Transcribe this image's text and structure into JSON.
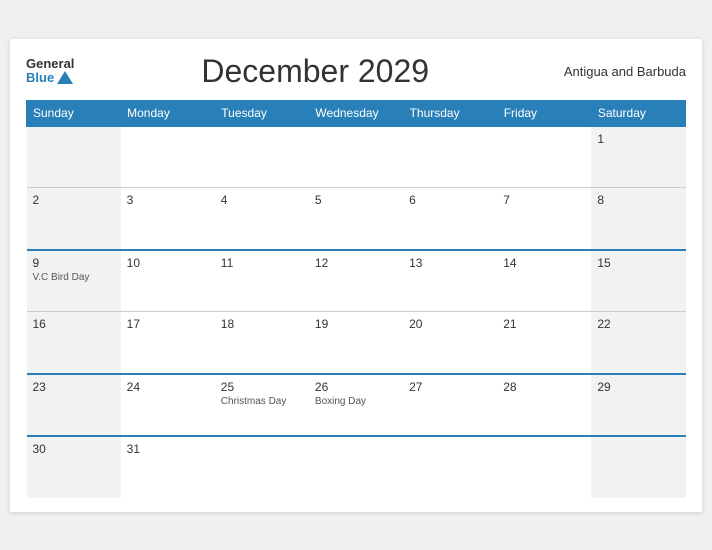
{
  "header": {
    "logo_general": "General",
    "logo_blue": "Blue",
    "title": "December 2029",
    "country": "Antigua and Barbuda"
  },
  "weekdays": [
    "Sunday",
    "Monday",
    "Tuesday",
    "Wednesday",
    "Thursday",
    "Friday",
    "Saturday"
  ],
  "weeks": [
    [
      {
        "day": "",
        "holiday": "",
        "type": "sunday"
      },
      {
        "day": "",
        "holiday": "",
        "type": ""
      },
      {
        "day": "",
        "holiday": "",
        "type": ""
      },
      {
        "day": "",
        "holiday": "",
        "type": ""
      },
      {
        "day": "",
        "holiday": "",
        "type": ""
      },
      {
        "day": "",
        "holiday": "",
        "type": ""
      },
      {
        "day": "1",
        "holiday": "",
        "type": "saturday"
      }
    ],
    [
      {
        "day": "2",
        "holiday": "",
        "type": "sunday"
      },
      {
        "day": "3",
        "holiday": "",
        "type": ""
      },
      {
        "day": "4",
        "holiday": "",
        "type": ""
      },
      {
        "day": "5",
        "holiday": "",
        "type": ""
      },
      {
        "day": "6",
        "holiday": "",
        "type": ""
      },
      {
        "day": "7",
        "holiday": "",
        "type": ""
      },
      {
        "day": "8",
        "holiday": "",
        "type": "saturday"
      }
    ],
    [
      {
        "day": "9",
        "holiday": "V.C Bird Day",
        "type": "sunday"
      },
      {
        "day": "10",
        "holiday": "",
        "type": ""
      },
      {
        "day": "11",
        "holiday": "",
        "type": ""
      },
      {
        "day": "12",
        "holiday": "",
        "type": ""
      },
      {
        "day": "13",
        "holiday": "",
        "type": ""
      },
      {
        "day": "14",
        "holiday": "",
        "type": ""
      },
      {
        "day": "15",
        "holiday": "",
        "type": "saturday"
      }
    ],
    [
      {
        "day": "16",
        "holiday": "",
        "type": "sunday"
      },
      {
        "day": "17",
        "holiday": "",
        "type": ""
      },
      {
        "day": "18",
        "holiday": "",
        "type": ""
      },
      {
        "day": "19",
        "holiday": "",
        "type": ""
      },
      {
        "day": "20",
        "holiday": "",
        "type": ""
      },
      {
        "day": "21",
        "holiday": "",
        "type": ""
      },
      {
        "day": "22",
        "holiday": "",
        "type": "saturday"
      }
    ],
    [
      {
        "day": "23",
        "holiday": "",
        "type": "sunday"
      },
      {
        "day": "24",
        "holiday": "",
        "type": ""
      },
      {
        "day": "25",
        "holiday": "Christmas Day",
        "type": ""
      },
      {
        "day": "26",
        "holiday": "Boxing Day",
        "type": ""
      },
      {
        "day": "27",
        "holiday": "",
        "type": ""
      },
      {
        "day": "28",
        "holiday": "",
        "type": ""
      },
      {
        "day": "29",
        "holiday": "",
        "type": "saturday"
      }
    ],
    [
      {
        "day": "30",
        "holiday": "",
        "type": "sunday"
      },
      {
        "day": "31",
        "holiday": "",
        "type": ""
      },
      {
        "day": "",
        "holiday": "",
        "type": ""
      },
      {
        "day": "",
        "holiday": "",
        "type": ""
      },
      {
        "day": "",
        "holiday": "",
        "type": ""
      },
      {
        "day": "",
        "holiday": "",
        "type": ""
      },
      {
        "day": "",
        "holiday": "",
        "type": "saturday"
      }
    ]
  ]
}
